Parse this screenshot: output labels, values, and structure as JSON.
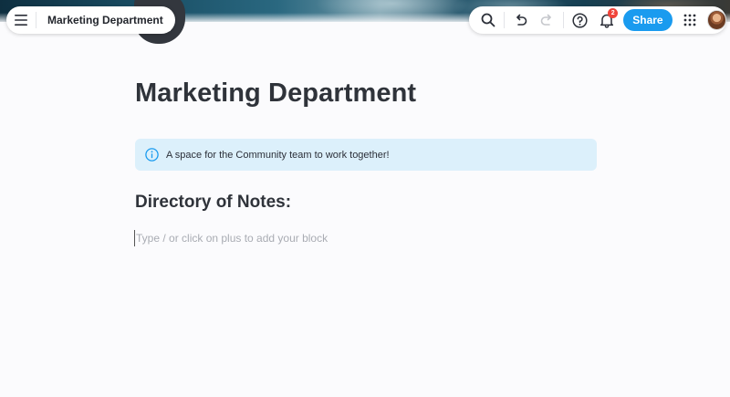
{
  "header": {
    "breadcrumb_title": "Marketing Department",
    "share_label": "Share",
    "notification_count": "2",
    "icons": [
      "menu-icon",
      "search-icon",
      "undo-icon",
      "redo-icon",
      "help-icon",
      "bell-icon",
      "apps-grid-icon"
    ]
  },
  "page": {
    "title": "Marketing Department",
    "callout": {
      "text": "A space for the Community team to work together!",
      "icon": "info-icon"
    },
    "section_heading": "Directory of Notes:",
    "block_placeholder": "Type / or click on plus to add your block"
  },
  "colors": {
    "accent": "#1a9bef",
    "callout_bg": "#dcf0fb",
    "badge": "#f0443a",
    "title": "#2f333a"
  }
}
